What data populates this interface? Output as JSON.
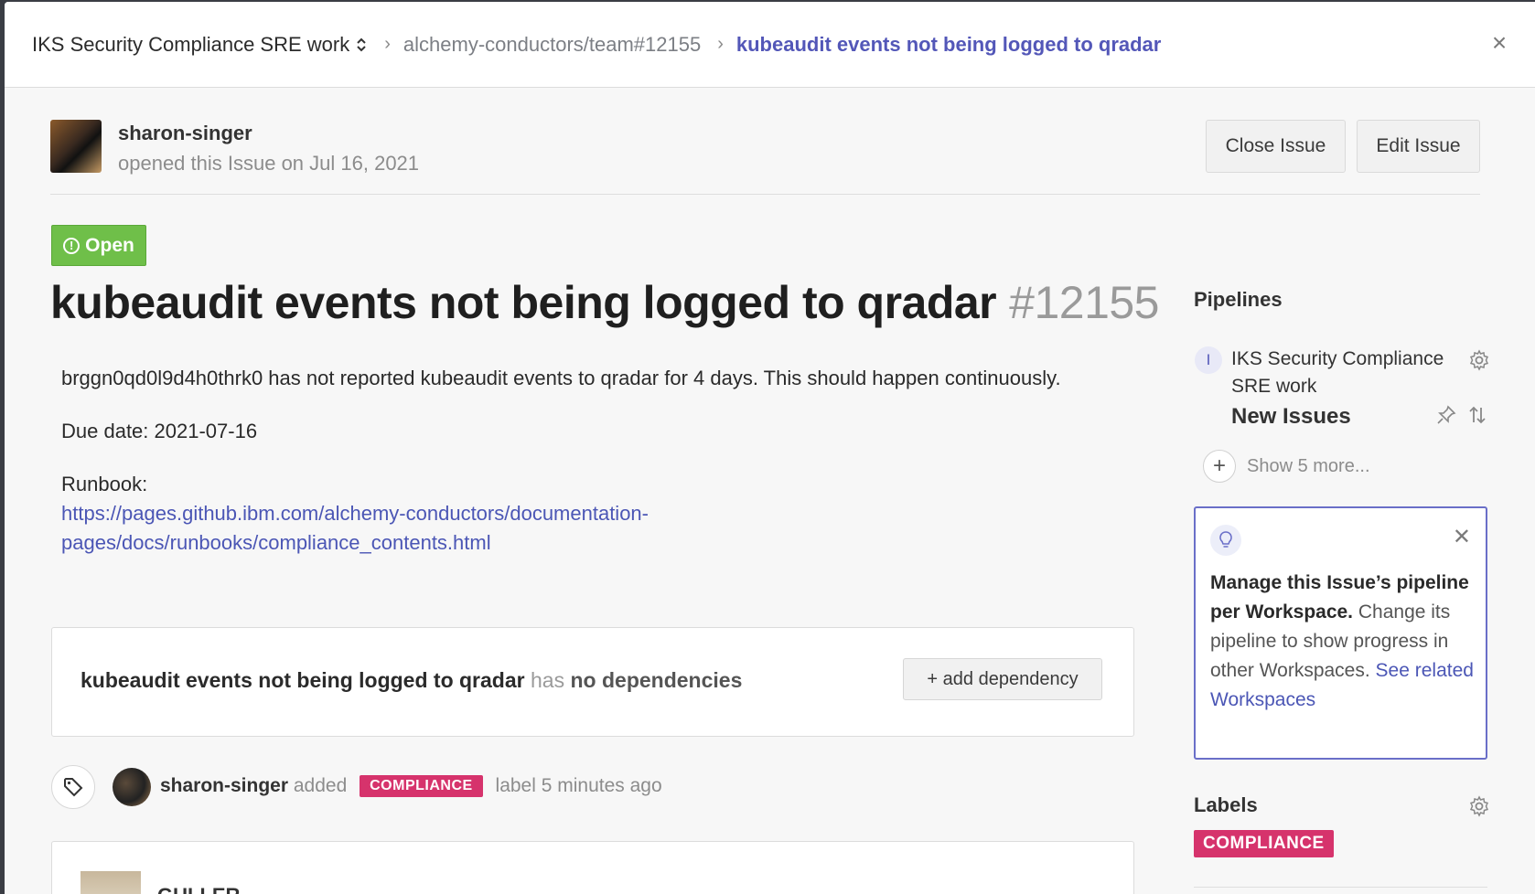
{
  "breadcrumb": {
    "workspace": "IKS Security Compliance SRE work",
    "repo": "alchemy-conductors/team#12155",
    "current": "kubeaudit events not being logged to qradar"
  },
  "author": {
    "name": "sharon-singer",
    "meta": "opened this Issue on Jul 16, 2021"
  },
  "actions": {
    "close": "Close Issue",
    "edit": "Edit Issue"
  },
  "status": "Open",
  "issue": {
    "title": "kubeaudit events not being logged to qradar",
    "number": "#12155",
    "body_p1": "brggn0qd0l9d4h0thrk0 has not reported kubeaudit events to qradar for 4 days. This should happen continuously.",
    "due": "Due date: 2021-07-16",
    "runbook_label": "Runbook:",
    "runbook_url_line1": "https://pages.github.ibm.com/alchemy-conductors/documentation-",
    "runbook_url_line2": "pages/docs/runbooks/compliance_contents.html"
  },
  "dependencies": {
    "title": "kubeaudit events not being logged to qradar",
    "has": "has",
    "none": "no dependencies",
    "button": "+ add dependency"
  },
  "activity": {
    "user": "sharon-singer",
    "verb": "added",
    "label": "COMPLIANCE",
    "suffix": "label 5 minutes ago"
  },
  "comment": {
    "name": "GULLER"
  },
  "sidebar": {
    "pipelines_heading": "Pipelines",
    "workspace_initial": "I",
    "workspace_name": "IKS Security Compliance SRE work",
    "pipeline_name": "New Issues",
    "show_more": "Show 5 more...",
    "tip": {
      "bold": "Manage this Issue’s pipeline per Workspace.",
      "text": "Change its pipeline to show progress in other Workspaces.",
      "link": "See related Workspaces"
    },
    "labels_heading": "Labels",
    "label": "COMPLIANCE"
  },
  "colors": {
    "accent": "#5357b8",
    "open_green": "#6fbf49",
    "label_pink": "#d6336c"
  }
}
